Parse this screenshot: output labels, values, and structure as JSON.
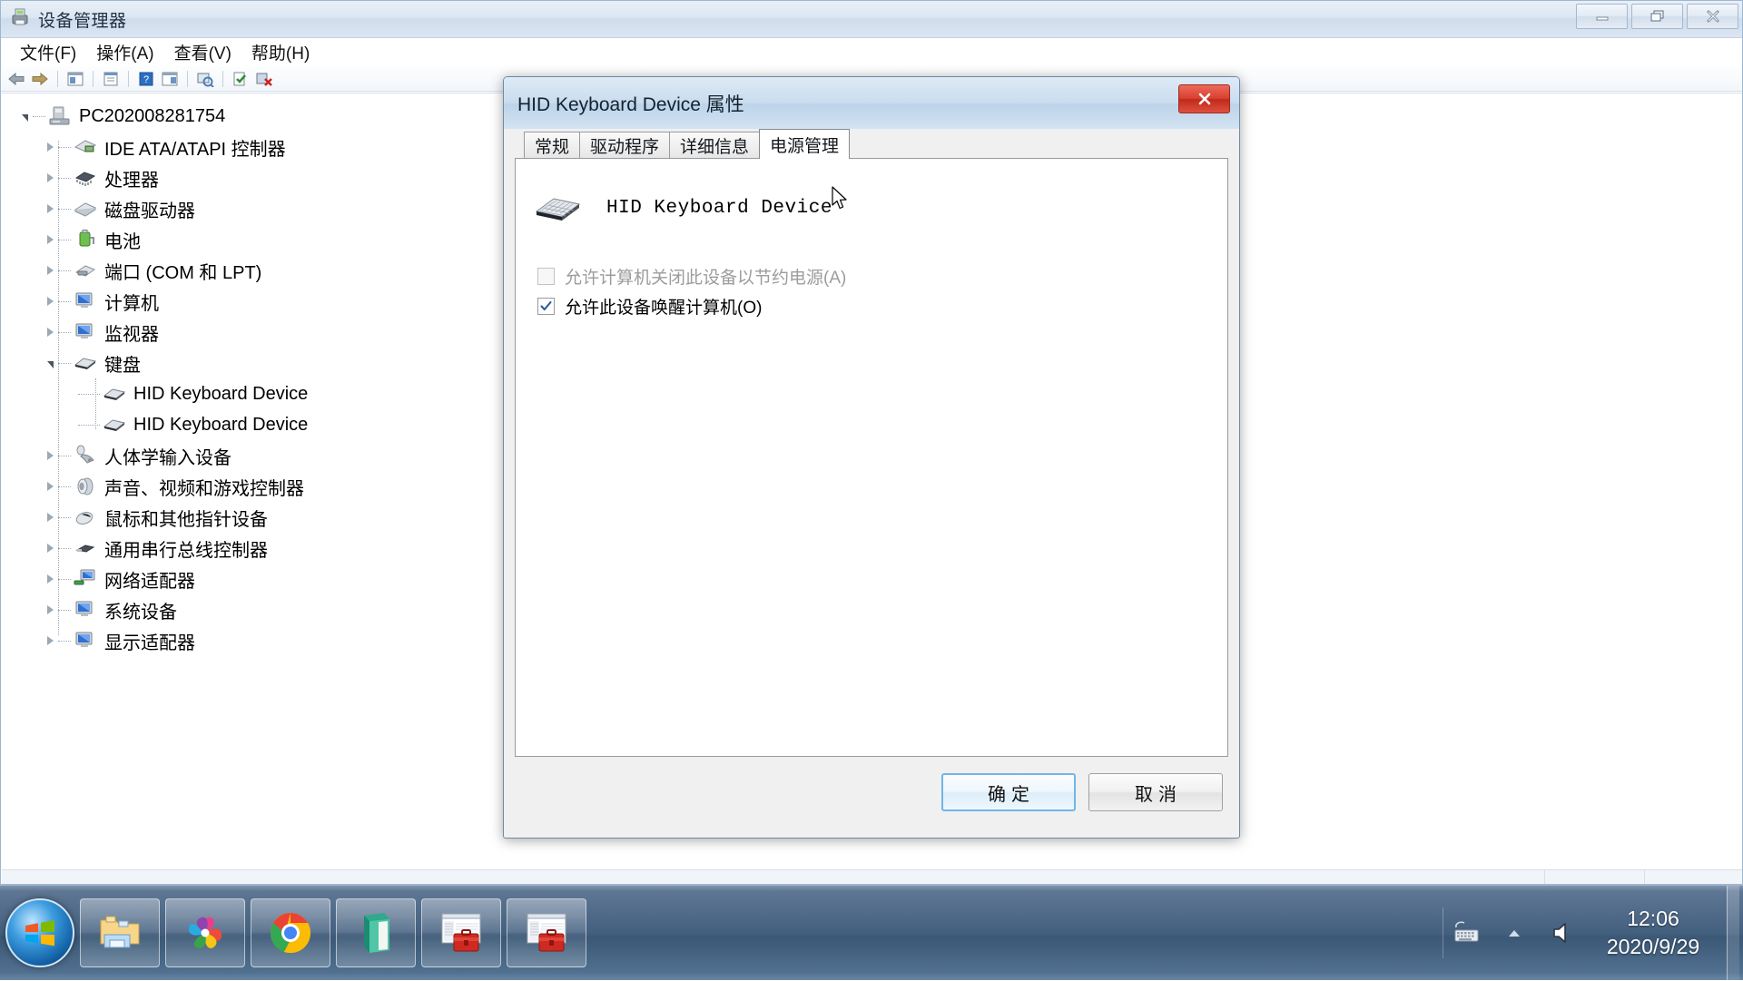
{
  "window": {
    "title": "设备管理器",
    "icon": "device-manager-icon",
    "controls": {
      "minimize": "─",
      "restore": "❐",
      "close": "✕"
    }
  },
  "menubar": {
    "items": [
      {
        "label": "文件(F)",
        "name": "menu-file"
      },
      {
        "label": "操作(A)",
        "name": "menu-action"
      },
      {
        "label": "查看(V)",
        "name": "menu-view"
      },
      {
        "label": "帮助(H)",
        "name": "menu-help"
      }
    ]
  },
  "toolbar": {
    "buttons": [
      {
        "name": "back-icon",
        "glyph": "←"
      },
      {
        "name": "forward-icon",
        "glyph": "→"
      },
      {
        "name": "show-hide-tree-icon",
        "glyph": "▤"
      },
      {
        "name": "properties-icon",
        "glyph": "▥"
      },
      {
        "name": "help-icon",
        "glyph": "?"
      },
      {
        "name": "update-driver-icon",
        "glyph": "▦"
      },
      {
        "name": "scan-hardware-changes-icon",
        "glyph": "↻"
      },
      {
        "name": "enable-device-icon",
        "glyph": "✔"
      },
      {
        "name": "uninstall-device-icon",
        "glyph": "✖"
      }
    ]
  },
  "tree": {
    "root": {
      "label": "PC202008281754",
      "icon": "computer-icon",
      "expanded": true
    },
    "nodes": [
      {
        "label": "IDE ATA/ATAPI 控制器",
        "icon": "ide-controller-icon",
        "expanded": false,
        "level": 1
      },
      {
        "label": "处理器",
        "icon": "processor-icon",
        "expanded": false,
        "level": 1
      },
      {
        "label": "磁盘驱动器",
        "icon": "disk-drive-icon",
        "expanded": false,
        "level": 1
      },
      {
        "label": "电池",
        "icon": "battery-icon",
        "expanded": false,
        "level": 1
      },
      {
        "label": "端口 (COM 和 LPT)",
        "icon": "port-icon",
        "expanded": false,
        "level": 1
      },
      {
        "label": "计算机",
        "icon": "monitor-icon",
        "expanded": false,
        "level": 1
      },
      {
        "label": "监视器",
        "icon": "monitor-icon",
        "expanded": false,
        "level": 1
      },
      {
        "label": "键盘",
        "icon": "keyboard-icon",
        "expanded": true,
        "level": 1
      },
      {
        "label": "HID Keyboard Device",
        "icon": "keyboard-icon",
        "leaf": true,
        "level": 2
      },
      {
        "label": "HID Keyboard Device",
        "icon": "keyboard-icon",
        "leaf": true,
        "level": 2
      },
      {
        "label": "人体学输入设备",
        "icon": "hid-icon",
        "expanded": false,
        "level": 1
      },
      {
        "label": "声音、视频和游戏控制器",
        "icon": "sound-icon",
        "expanded": false,
        "level": 1
      },
      {
        "label": "鼠标和其他指针设备",
        "icon": "mouse-icon",
        "expanded": false,
        "level": 1
      },
      {
        "label": "通用串行总线控制器",
        "icon": "usb-icon",
        "expanded": false,
        "level": 1
      },
      {
        "label": "网络适配器",
        "icon": "network-icon",
        "expanded": false,
        "level": 1
      },
      {
        "label": "系统设备",
        "icon": "system-device-icon",
        "expanded": false,
        "level": 1
      },
      {
        "label": "显示适配器",
        "icon": "display-adapter-icon",
        "expanded": false,
        "level": 1
      }
    ]
  },
  "dialog": {
    "title": "HID Keyboard Device 属性",
    "close_glyph": "✕",
    "tabs": [
      {
        "label": "常规",
        "name": "tab-general",
        "active": false
      },
      {
        "label": "驱动程序",
        "name": "tab-driver",
        "active": false
      },
      {
        "label": "详细信息",
        "name": "tab-details",
        "active": false
      },
      {
        "label": "电源管理",
        "name": "tab-power-management",
        "active": true
      }
    ],
    "device": {
      "name": "HID Keyboard Device",
      "icon": "keyboard-icon"
    },
    "checkboxes": [
      {
        "label": "允许计算机关闭此设备以节约电源(A)",
        "checked": false,
        "disabled": true,
        "name": "allow-computer-turn-off-device-checkbox"
      },
      {
        "label": "允许此设备唤醒计算机(O)",
        "checked": true,
        "disabled": false,
        "name": "allow-device-wake-computer-checkbox"
      }
    ],
    "buttons": [
      {
        "label": "确定",
        "name": "ok-button",
        "default": true
      },
      {
        "label": "取消",
        "name": "cancel-button",
        "default": false
      }
    ]
  },
  "taskbar": {
    "start": "start-orb",
    "tasks": [
      {
        "name": "taskbar-explorer",
        "icon": "folder-icon"
      },
      {
        "name": "taskbar-360-browser",
        "icon": "pinwheel-icon"
      },
      {
        "name": "taskbar-chrome",
        "icon": "chrome-icon"
      },
      {
        "name": "taskbar-book-app",
        "icon": "green-book-icon"
      },
      {
        "name": "taskbar-device-manager-1",
        "icon": "toolbox-window-icon"
      },
      {
        "name": "taskbar-device-manager-2",
        "icon": "toolbox-window-icon"
      }
    ],
    "tray": [
      {
        "name": "tray-keyboard-icon",
        "icon": "keyboard-icon"
      },
      {
        "name": "tray-show-hidden-icon",
        "icon": "chevron-up-icon"
      },
      {
        "name": "tray-volume-icon",
        "icon": "speaker-icon"
      }
    ],
    "clock": {
      "time": "12:06",
      "date": "2020/9/29"
    }
  }
}
